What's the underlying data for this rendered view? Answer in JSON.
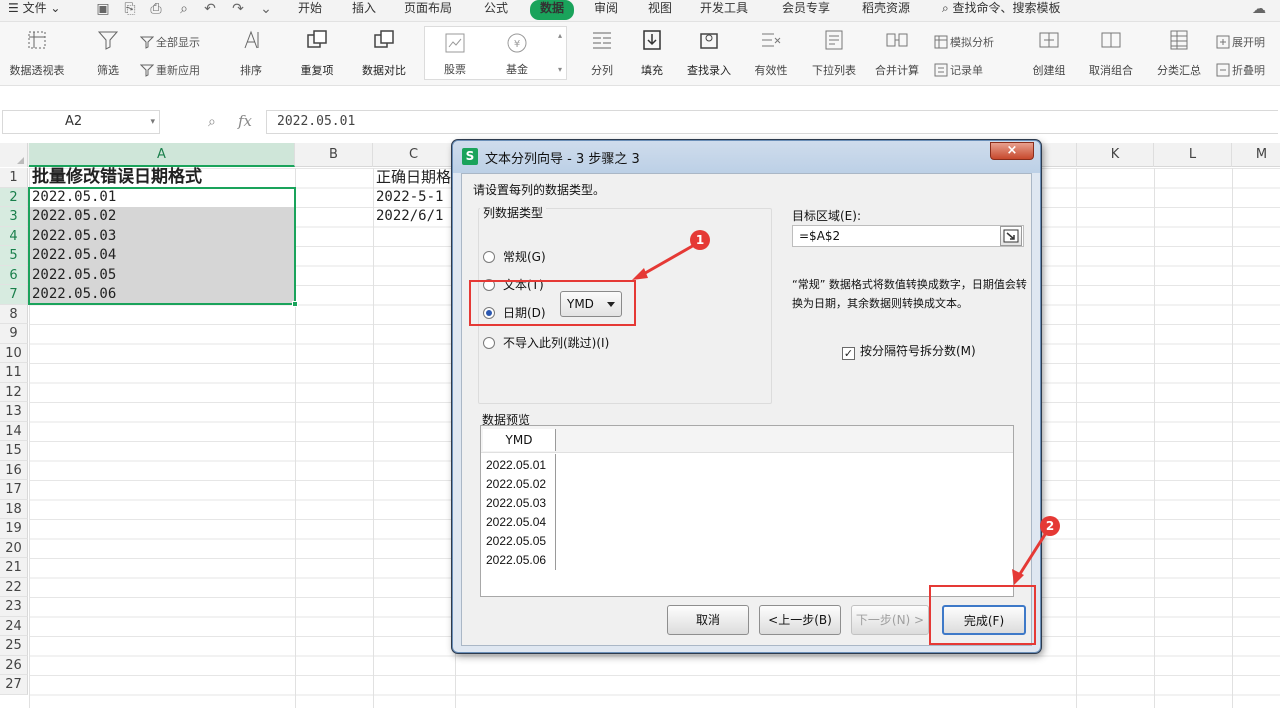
{
  "menubar": {
    "file": "文件",
    "tabs": [
      "开始",
      "插入",
      "页面布局",
      "公式",
      "数据",
      "审阅",
      "视图",
      "开发工具",
      "会员专享",
      "稻壳资源"
    ],
    "search": "查找命令、搜索模板"
  },
  "ribbon": {
    "pivot": "数据透视表",
    "filter": "筛选",
    "show_all": "全部显示",
    "reapply": "重新应用",
    "sort": "排序",
    "duplicates": "重复项",
    "compare": "数据对比",
    "stock": "股票",
    "fund": "基金",
    "split": "分列",
    "fill": "填充",
    "lookup": "查找录入",
    "validity": "有效性",
    "dropdown": "下拉列表",
    "consolidate": "合并计算",
    "simulate": "模拟分析",
    "record": "记录单",
    "group": "创建组",
    "ungroup": "取消组合",
    "subtotal": "分类汇总",
    "expand": "展开明",
    "collapse": "折叠明"
  },
  "formula_bar": {
    "cell_ref": "A2",
    "fx": "fx",
    "value": "2022.05.01"
  },
  "sheet": {
    "columns": [
      "A",
      "B",
      "C",
      "K",
      "L",
      "M"
    ],
    "rows": [
      "1",
      "2",
      "3",
      "4",
      "5",
      "6",
      "7",
      "8",
      "9",
      "10",
      "11",
      "12",
      "13",
      "14",
      "15",
      "16",
      "17",
      "18",
      "19",
      "20",
      "21",
      "22",
      "23",
      "24",
      "25",
      "26",
      "27"
    ],
    "a1": "批量修改错误日期格式",
    "a_values": [
      "2022.05.01",
      "2022.05.02",
      "2022.05.03",
      "2022.05.04",
      "2022.05.05",
      "2022.05.06"
    ],
    "c1": "正确日期格",
    "c_values": [
      "2022-5-1",
      "2022/6/1"
    ]
  },
  "dialog": {
    "title": "文本分列向导 - 3 步骤之 3",
    "close": "×",
    "instruction": "请设置每列的数据类型。",
    "column_type_label": "列数据类型",
    "options": [
      {
        "label": "常规(G)",
        "selected": false
      },
      {
        "label": "文本(T)",
        "selected": false
      },
      {
        "label": "日期(D)",
        "selected": true
      },
      {
        "label": "不导入此列(跳过)(I)",
        "selected": false
      }
    ],
    "date_format": "YMD",
    "target_label": "目标区域(E):",
    "target_value": "=$A$2",
    "help_text": "“常规” 数据格式将数值转换成数字，日期值会转换为日期，其余数据则转换成文本。",
    "sep_checkbox": "按分隔符号拆分数(M)",
    "preview_label": "数据预览",
    "preview_header": "YMD",
    "preview_rows": [
      "2022.05.01",
      "2022.05.02",
      "2022.05.03",
      "2022.05.04",
      "2022.05.05",
      "2022.05.06"
    ],
    "buttons": {
      "cancel": "取消",
      "back": "<上一步(B)",
      "next": "下一步(N) >",
      "finish": "完成(F)"
    }
  },
  "annotations": [
    "1",
    "2"
  ],
  "colors": {
    "accent": "#1aa35b",
    "annotation": "#e53935",
    "selection": "#d6d6d6"
  }
}
